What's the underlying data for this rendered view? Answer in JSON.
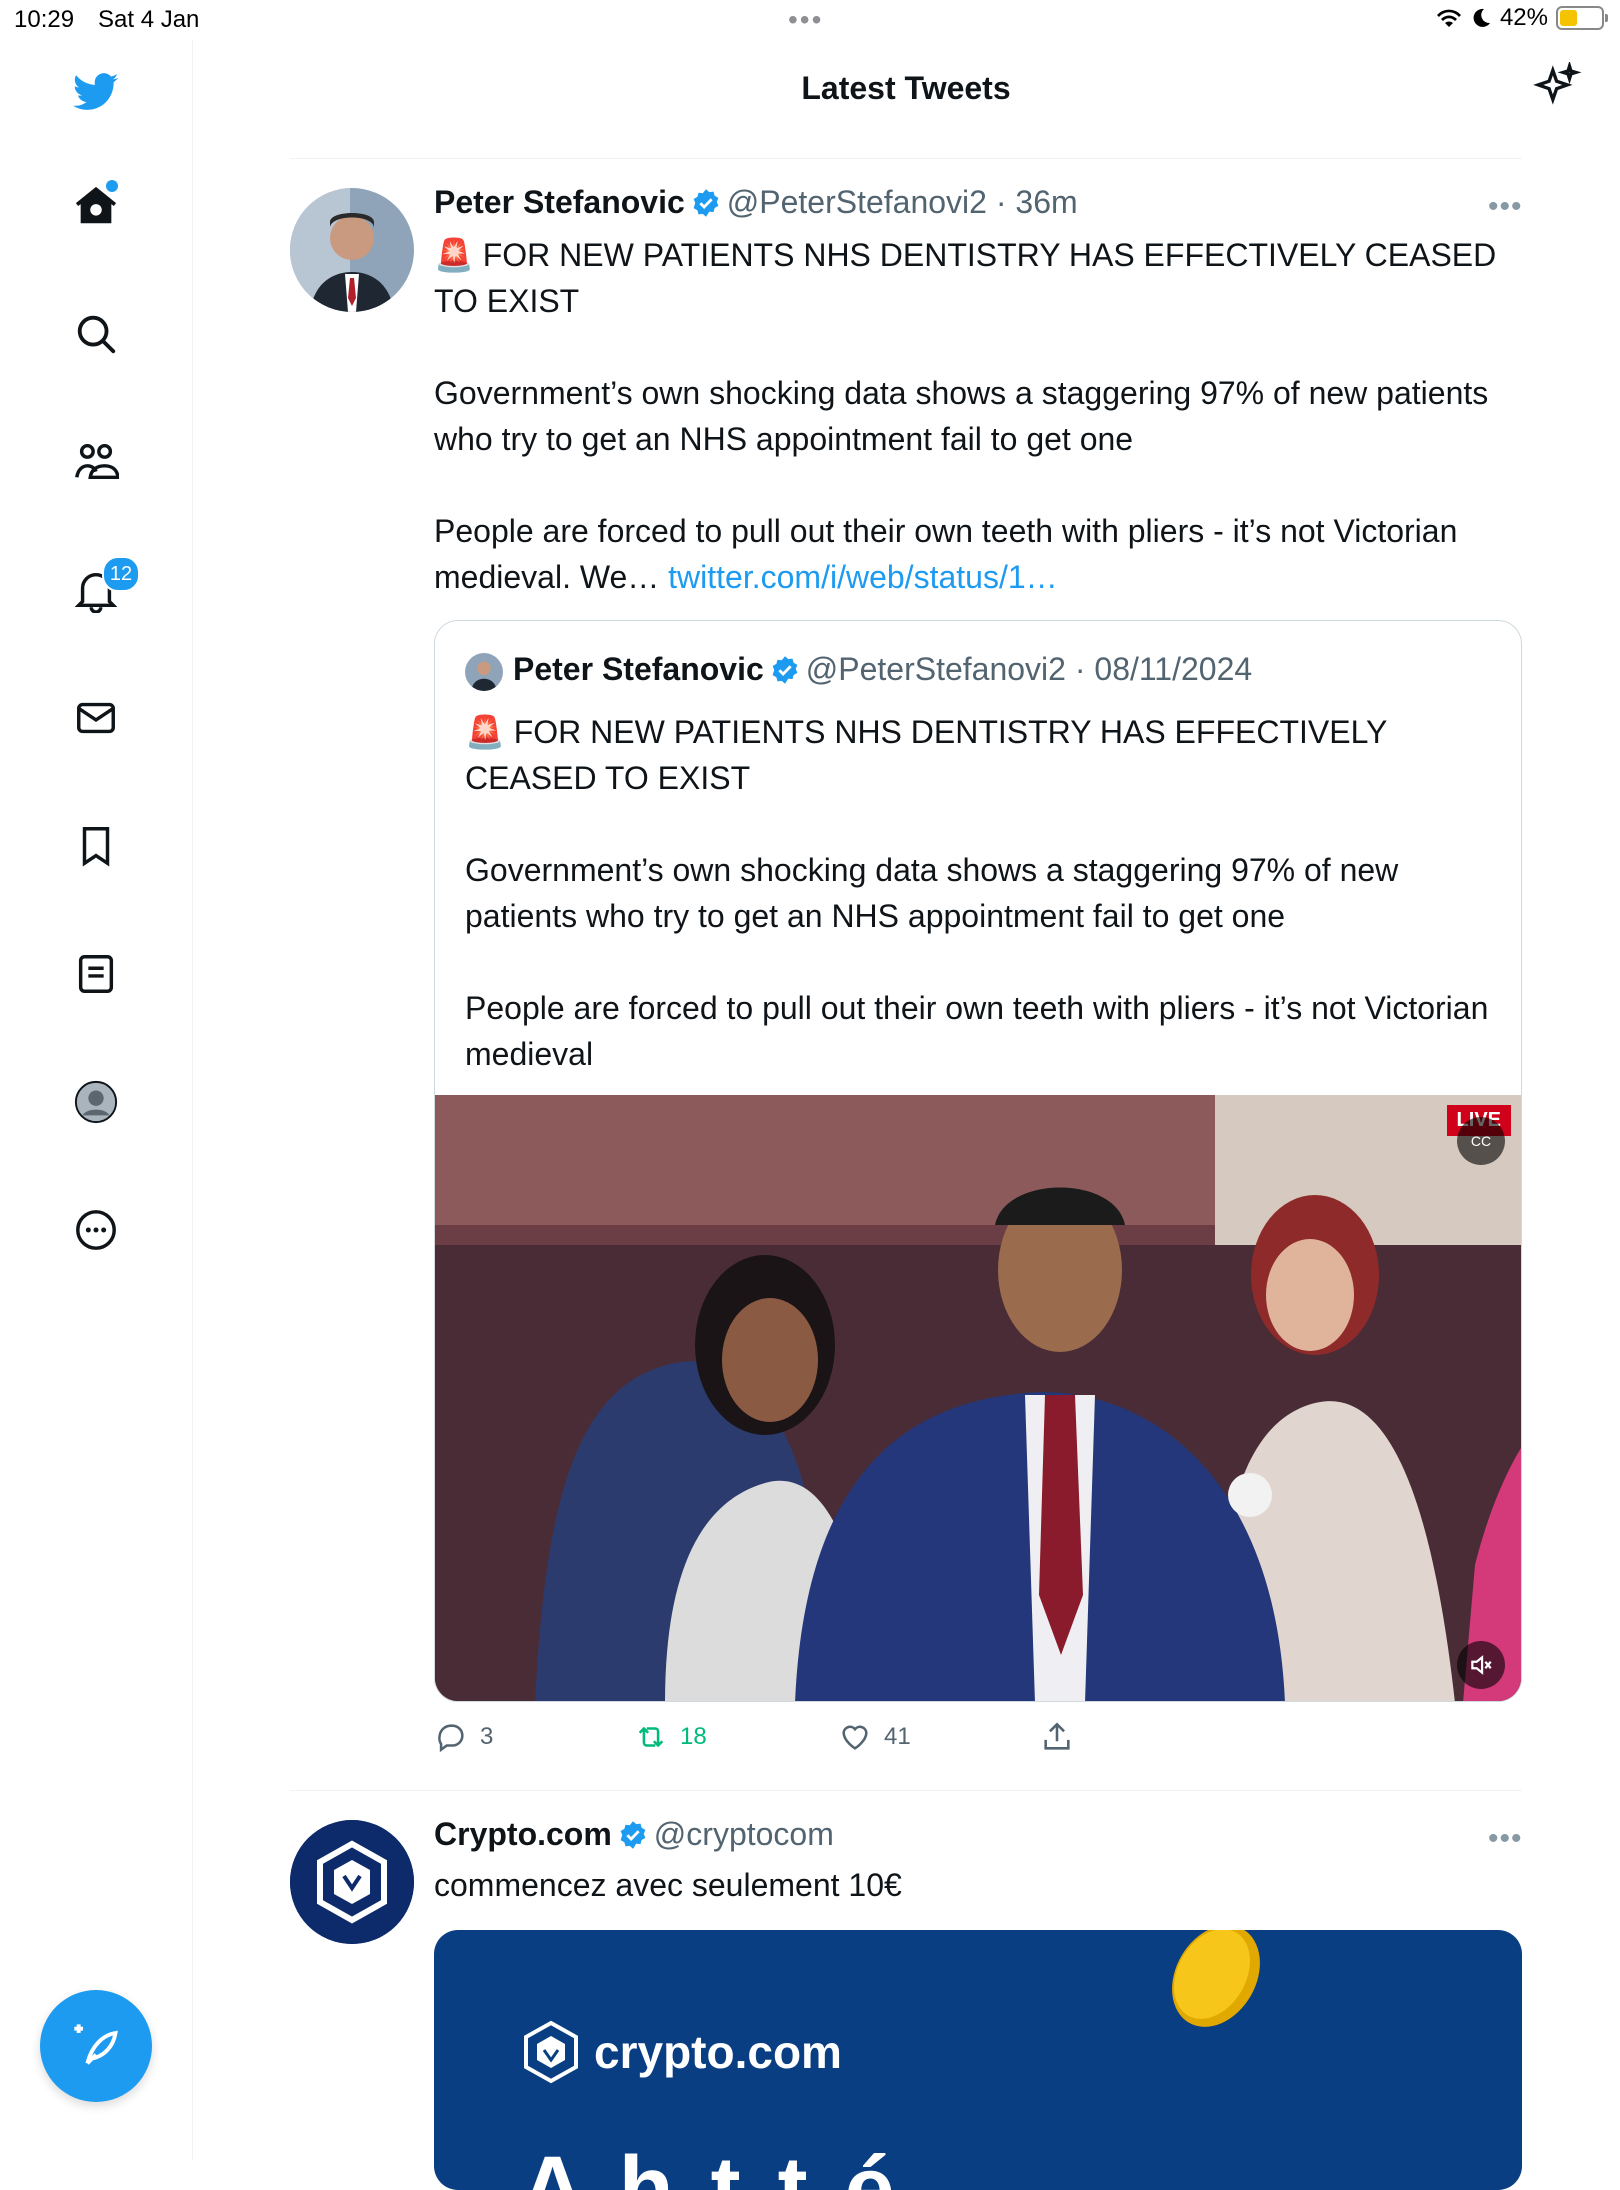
{
  "status_bar": {
    "time": "10:29",
    "date": "Sat 4 Jan",
    "battery": "42%",
    "battery_level": 0.42
  },
  "header": {
    "title": "Latest Tweets"
  },
  "sidebar": {
    "icons": [
      "twitter-logo-icon",
      "home-icon",
      "search-icon",
      "communities-icon",
      "notifications-icon",
      "messages-icon",
      "bookmarks-icon",
      "lists-icon",
      "profile-icon",
      "more-icon"
    ],
    "notifications_badge": "12",
    "compose_icon": "compose-tweet-icon"
  },
  "colors": {
    "accent": "#1d9bf0",
    "retweet_green": "#00ba7c",
    "text": "#0f1419",
    "muted": "#536471"
  },
  "tweets": [
    {
      "name": "Peter Stefanovic",
      "handle": "@PeterStefanovi2",
      "time": "· 36m",
      "text": "🚨 FOR NEW PATIENTS NHS DENTISTRY HAS EFFECTIVELY CEASED TO EXIST\n\nGovernment’s own shocking data shows a staggering 97% of new patients who try to get an NHS appointment fail to get one\n\nPeople are forced to pull out their own teeth with pliers - it’s not Victorian medieval. We… ",
      "link": "twitter.com/i/web/status/1…",
      "quote": {
        "name": "Peter Stefanovic",
        "handle": "@PeterStefanovi2",
        "time": "· 08/11/2024",
        "text": "🚨 FOR NEW PATIENTS NHS DENTISTRY HAS EFFECTIVELY CEASED TO EXIST\n\nGovernment’s own shocking data shows a staggering 97% of new patients who try to get an NHS appointment fail to get one\n\nPeople are forced to pull out their own teeth with pliers - it’s not Victorian medieval",
        "video_badge": "LIVE",
        "captions_label": "CC"
      },
      "actions": {
        "replies": "3",
        "retweets": "18",
        "likes": "41"
      }
    },
    {
      "name": "Crypto.com",
      "handle": "@cryptocom",
      "text": "commencez avec seulement 10€",
      "promo_logo_text": "crypto.com",
      "promo_text": "A h t t é"
    }
  ]
}
